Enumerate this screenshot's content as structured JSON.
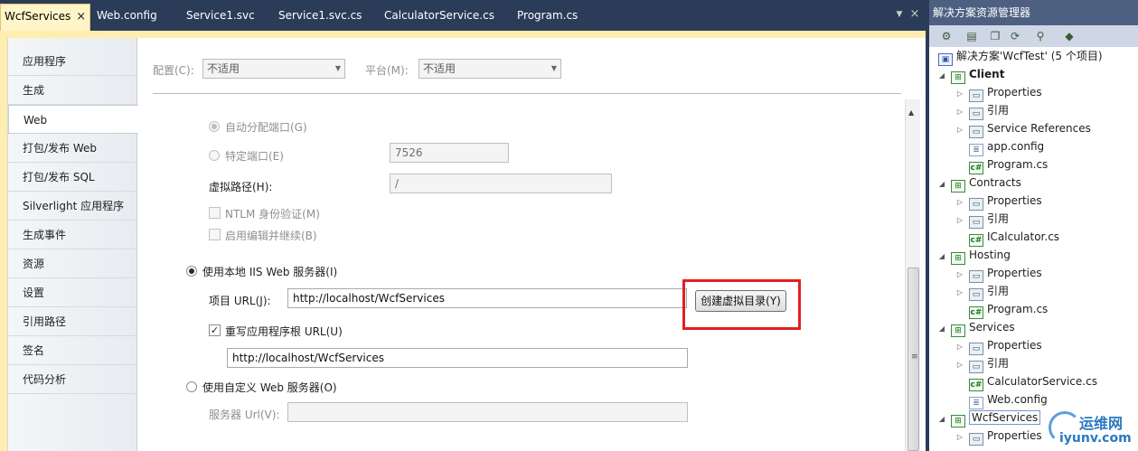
{
  "tabs": [
    {
      "label": "WcfServices",
      "active": true
    },
    {
      "label": "Web.config"
    },
    {
      "label": "Service1.svc"
    },
    {
      "label": "Service1.svc.cs"
    },
    {
      "label": "CalculatorService.cs"
    },
    {
      "label": "Program.cs"
    }
  ],
  "tab_close_glyph": "×",
  "nav": [
    {
      "label": "应用程序"
    },
    {
      "label": "生成"
    },
    {
      "label": "Web",
      "active": true
    },
    {
      "label": "打包/发布 Web"
    },
    {
      "label": "打包/发布 SQL"
    },
    {
      "label": "Silverlight 应用程序"
    },
    {
      "label": "生成事件"
    },
    {
      "label": "资源"
    },
    {
      "label": "设置"
    },
    {
      "label": "引用路径"
    },
    {
      "label": "签名"
    },
    {
      "label": "代码分析"
    }
  ],
  "config": {
    "config_label": "配置(C):",
    "config_value": "不适用",
    "platform_label": "平台(M):",
    "platform_value": "不适用"
  },
  "web": {
    "auto_port_label": "自动分配端口(G)",
    "specific_port_label": "特定端口(E)",
    "specific_port_value": "7526",
    "virtual_path_label": "虚拟路径(H):",
    "virtual_path_value": "/",
    "ntlm_label": "NTLM 身份验证(M)",
    "edit_continue_label": "启用编辑并继续(B)",
    "use_iis_label": "使用本地 IIS Web 服务器(I)",
    "project_url_label": "项目 URL(J):",
    "project_url_value": "http://localhost/WcfServices",
    "create_vdir_button": "创建虚拟目录(Y)",
    "override_root_label": "重写应用程序根 URL(U)",
    "override_root_value": "http://localhost/WcfServices",
    "use_custom_label": "使用自定义 Web 服务器(O)",
    "server_url_label": "服务器 Url(V):",
    "server_url_value": ""
  },
  "solution": {
    "title": "解决方案资源管理器",
    "root": "解决方案'WcfTest' (5 个项目)",
    "nodes": [
      {
        "label": "Client",
        "bold": true,
        "level": 1,
        "type": "proj"
      },
      {
        "label": "Properties",
        "level": 2,
        "type": "folder"
      },
      {
        "label": "引用",
        "level": 2,
        "type": "folder"
      },
      {
        "label": "Service References",
        "level": 2,
        "type": "folder"
      },
      {
        "label": "app.config",
        "level": 2,
        "type": "cfg"
      },
      {
        "label": "Program.cs",
        "level": 2,
        "type": "cs"
      },
      {
        "label": "Contracts",
        "level": 1,
        "type": "proj"
      },
      {
        "label": "Properties",
        "level": 2,
        "type": "folder"
      },
      {
        "label": "引用",
        "level": 2,
        "type": "folder"
      },
      {
        "label": "ICalculator.cs",
        "level": 2,
        "type": "cs"
      },
      {
        "label": "Hosting",
        "level": 1,
        "type": "proj"
      },
      {
        "label": "Properties",
        "level": 2,
        "type": "folder"
      },
      {
        "label": "引用",
        "level": 2,
        "type": "folder"
      },
      {
        "label": "Program.cs",
        "level": 2,
        "type": "cs"
      },
      {
        "label": "Services",
        "level": 1,
        "type": "proj"
      },
      {
        "label": "Properties",
        "level": 2,
        "type": "folder"
      },
      {
        "label": "引用",
        "level": 2,
        "type": "folder"
      },
      {
        "label": "CalculatorService.cs",
        "level": 2,
        "type": "cs"
      },
      {
        "label": "Web.config",
        "level": 2,
        "type": "cfg"
      },
      {
        "label": "WcfServices",
        "level": 1,
        "type": "proj",
        "selected": true
      },
      {
        "label": "Properties",
        "level": 2,
        "type": "folder"
      }
    ]
  },
  "watermark": {
    "line1": "运维网",
    "line2": "iyunv.com"
  },
  "colors": {
    "accent_highlight": "#e02020",
    "tab_active": "#fff5c8",
    "chrome": "#2b3c59"
  }
}
